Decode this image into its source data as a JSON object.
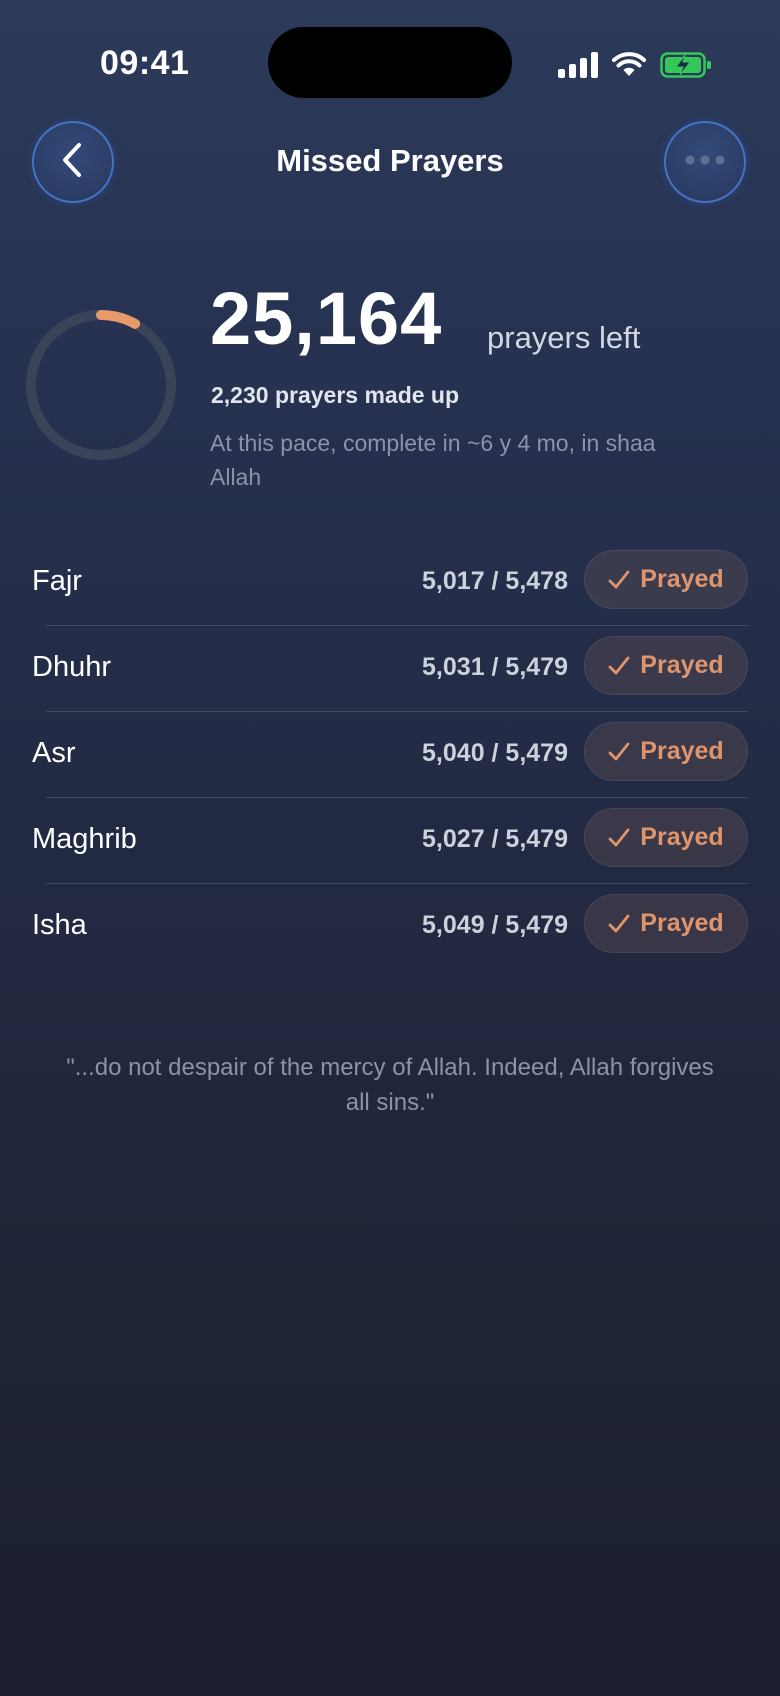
{
  "status_bar": {
    "time": "09:41"
  },
  "header": {
    "title": "Missed Prayers",
    "back_icon": "chevron-left-icon",
    "more_icon": "ellipsis-icon"
  },
  "summary": {
    "prayers_left": "25,164",
    "prayers_left_label": "prayers left",
    "made_up_text": "2,230 prayers made up",
    "pace_text": "At this pace, complete in ~6 y 4 mo, in shaa Allah",
    "progress_fraction": 0.081,
    "progress_color": "#e99a6c"
  },
  "prayers": [
    {
      "name": "Fajr",
      "count": "5,017 / 5,478",
      "button": "Prayed"
    },
    {
      "name": "Dhuhr",
      "count": "5,031 / 5,479",
      "button": "Prayed"
    },
    {
      "name": "Asr",
      "count": "5,040 / 5,479",
      "button": "Prayed"
    },
    {
      "name": "Maghrib",
      "count": "5,027 / 5,479",
      "button": "Prayed"
    },
    {
      "name": "Isha",
      "count": "5,049 / 5,479",
      "button": "Prayed"
    }
  ],
  "quote": "\"...do not despair of the mercy of Allah. Indeed, Allah forgives all sins.\"",
  "colors": {
    "accent": "#e0946c",
    "button_border": "#4a7cd6",
    "battery": "#34c759"
  }
}
